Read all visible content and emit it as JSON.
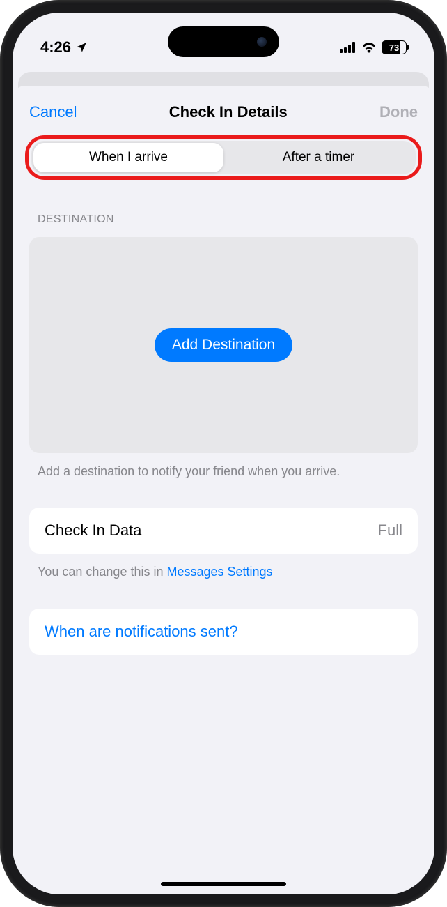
{
  "statusBar": {
    "time": "4:26",
    "batteryLevel": "73"
  },
  "nav": {
    "cancel": "Cancel",
    "title": "Check In Details",
    "done": "Done"
  },
  "segmented": {
    "arrive": "When I arrive",
    "timer": "After a timer"
  },
  "destination": {
    "header": "DESTINATION",
    "addButton": "Add Destination",
    "footer": "Add a destination to notify your friend when you arrive."
  },
  "checkInData": {
    "label": "Check In Data",
    "value": "Full",
    "footerPrefix": "You can change this in ",
    "footerLink": "Messages Settings"
  },
  "notificationsLink": "When are notifications sent?"
}
